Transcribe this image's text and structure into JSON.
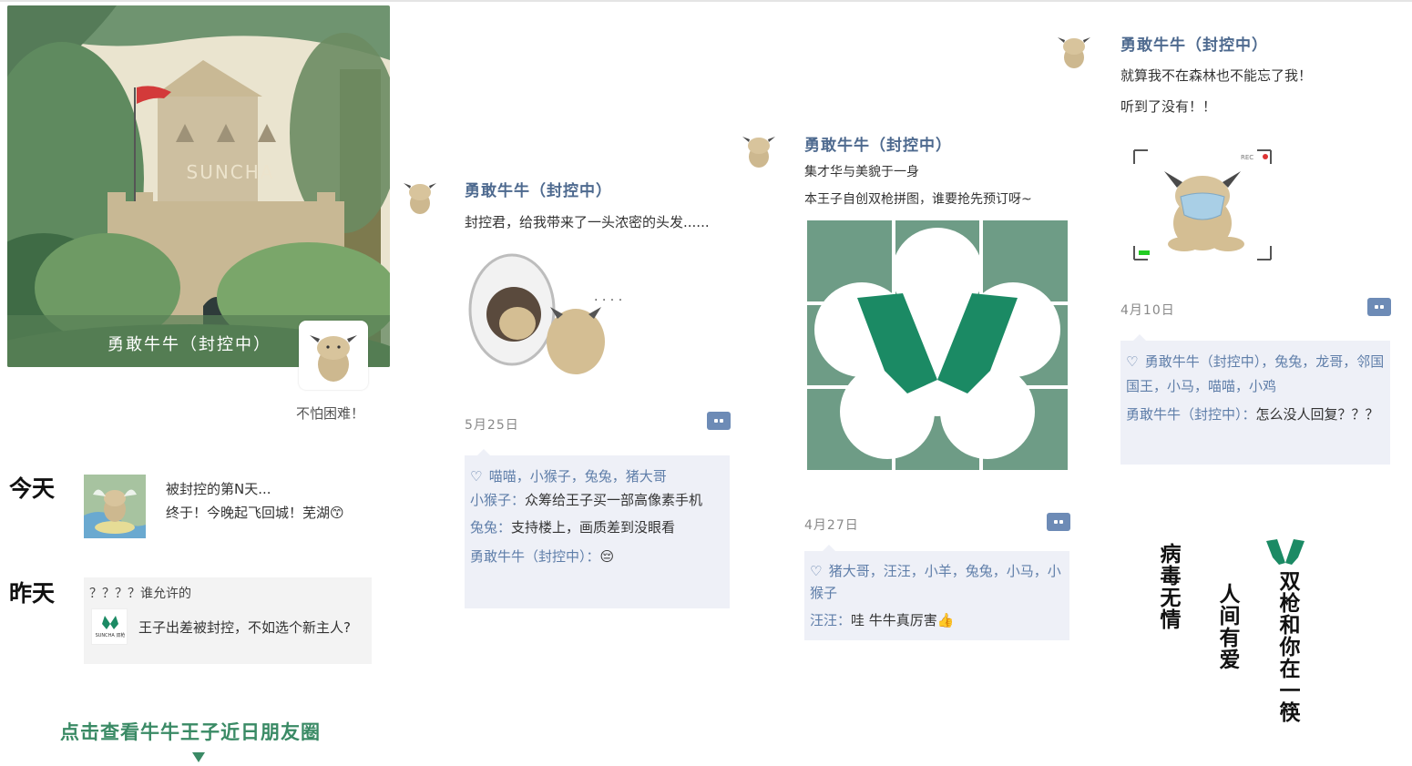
{
  "cover": {
    "brand_text": "SUNCHA",
    "user_name": "勇敢牛牛（封控中）",
    "signature": "不怕困难！"
  },
  "today": {
    "label": "今天",
    "line1": "被封控的第N天...",
    "line2": "终于！今晚起飞回城！芜湖😙"
  },
  "yesterday": {
    "label": "昨天",
    "title": "？？？？谁允许的",
    "logo_text": "SUNCHA 双枪",
    "text": "王子出差被封控，不如选个新主人?"
  },
  "cta": {
    "text": "点击查看牛牛王子近日朋友圈"
  },
  "post1": {
    "name": "勇敢牛牛（封控中）",
    "text": "封控君，给我带来了一头浓密的头发......",
    "date": "5月25日",
    "likes": "喵喵，小猴子，兔兔，猪大哥",
    "comments": [
      {
        "name": "小猴子：",
        "text": "众筹给王子买一部高像素手机"
      },
      {
        "name": "兔兔：",
        "text": "支持楼上，画质差到没眼看"
      },
      {
        "name": "勇敢牛牛（封控中）：",
        "text": "😔"
      }
    ]
  },
  "post2": {
    "name": "勇敢牛牛（封控中）",
    "line1": "集才华与美貌于一身",
    "line2": "本王子自创双枪拼图，谁要抢先预订呀~",
    "date": "4月27日",
    "likes": "猪大哥，汪汪，小羊，兔兔，小马，小猴子",
    "comments": [
      {
        "name": "汪汪：",
        "text": "哇 牛牛真厉害👍"
      }
    ]
  },
  "post3": {
    "name": "勇敢牛牛（封控中）",
    "line1": "就算我不在森林也不能忘了我！",
    "line2": "听到了没有！！",
    "photo_corner_text": "REC",
    "date": "4月10日",
    "likes": "勇敢牛牛（封控中），兔兔，龙哥，邻国国王，小马，喵喵，小鸡",
    "comments": [
      {
        "name": "勇敢牛牛（封控中）：",
        "text": "怎么没人回复？？？"
      }
    ]
  },
  "slogans": {
    "col1": "病毒无情",
    "col2": "人间有爱",
    "col3": "双枪和你在一筷"
  },
  "colors": {
    "brand_green": "#1b8a64",
    "name_blue": "#4e6a8f",
    "comment_bg": "#eef0f7",
    "puzzle_bg": "#6e9c86"
  }
}
